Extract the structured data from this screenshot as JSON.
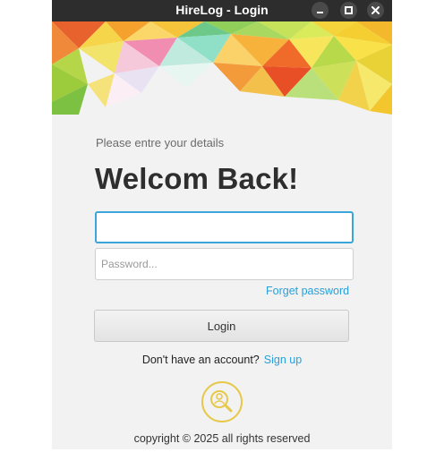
{
  "window": {
    "title": "HireLog - Login",
    "controls": [
      "minimize-icon",
      "maximize-icon",
      "close-icon"
    ]
  },
  "form": {
    "subtitle": "Please entre your details",
    "heading": "Welcom Back!",
    "username": {
      "value": "",
      "placeholder": ""
    },
    "password": {
      "value": "",
      "placeholder": "Password..."
    },
    "forgot_label": "Forget password",
    "login_label": "Login",
    "signup_prompt": "Don't have an account?",
    "signup_label": "Sign up"
  },
  "logo": {
    "icon": "search-person-icon",
    "color": "#e6c84a"
  },
  "footer": {
    "copyright": "copyright © 2025 all rights reserved"
  },
  "colors": {
    "accent": "#2a9fd8",
    "titlebar": "#2d2d2d",
    "background": "#f2f2f2"
  }
}
